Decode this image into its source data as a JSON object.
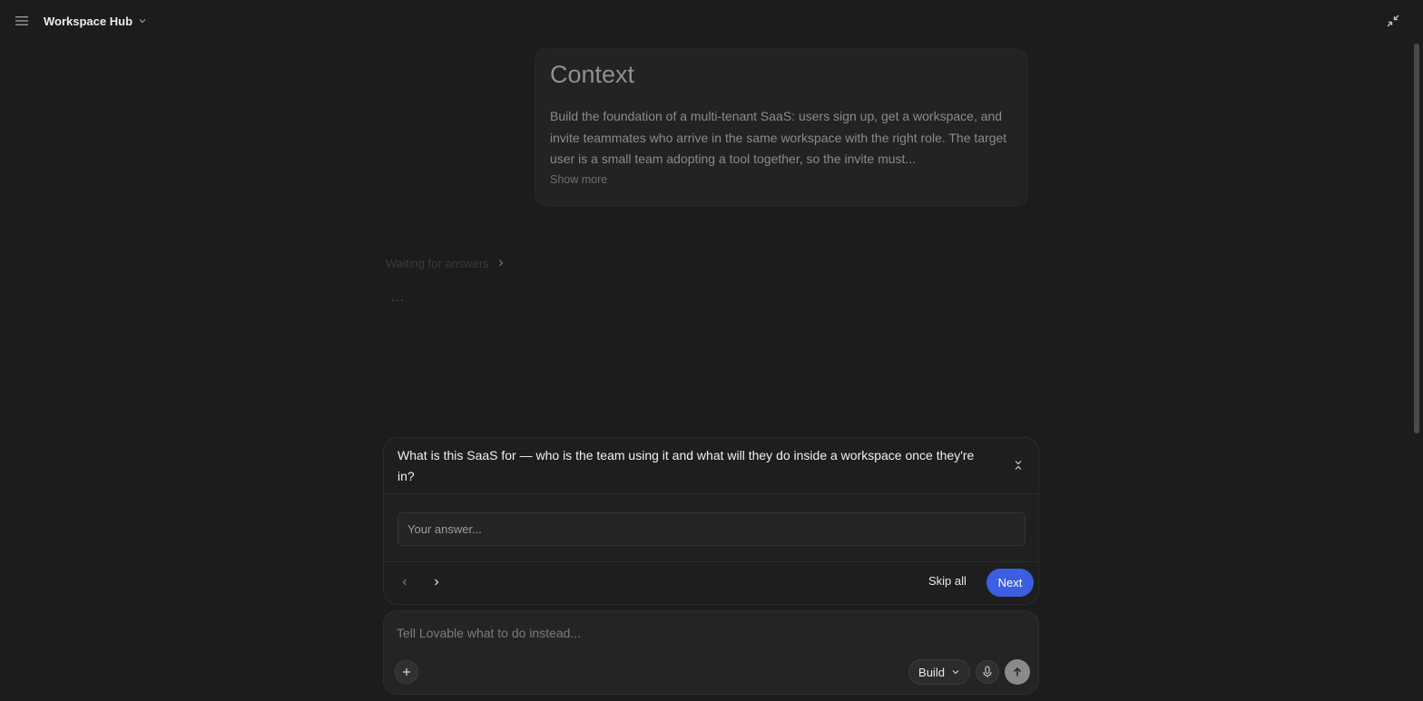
{
  "header": {
    "project_name": "Workspace Hub",
    "icons": [
      "hamburger-menu-icon",
      "chevron-down-icon",
      "collapse-arrows-icon"
    ]
  },
  "context": {
    "title": "Context",
    "body": "Build the foundation of a multi-tenant SaaS: users sign up, get a workspace, and invite teammates who arrive in the same workspace with the right role. The target user is a small team adopting a tool together, so the invite must...",
    "show_more": "Show more"
  },
  "status": {
    "waiting_label": "Waiting for answers",
    "ellipsis": "..."
  },
  "question": {
    "text": "What is this SaaS for — who is the team using it and what will they do inside a workspace once they're in?",
    "answer_placeholder": "Your answer...",
    "answer_value": "",
    "skip_all_label": "Skip all",
    "next_label": "Next"
  },
  "composer": {
    "placeholder": "Tell Lovable what to do instead...",
    "mode_label": "Build"
  },
  "colors": {
    "background": "#1c1c1c",
    "accent": "#3b5fe0"
  }
}
